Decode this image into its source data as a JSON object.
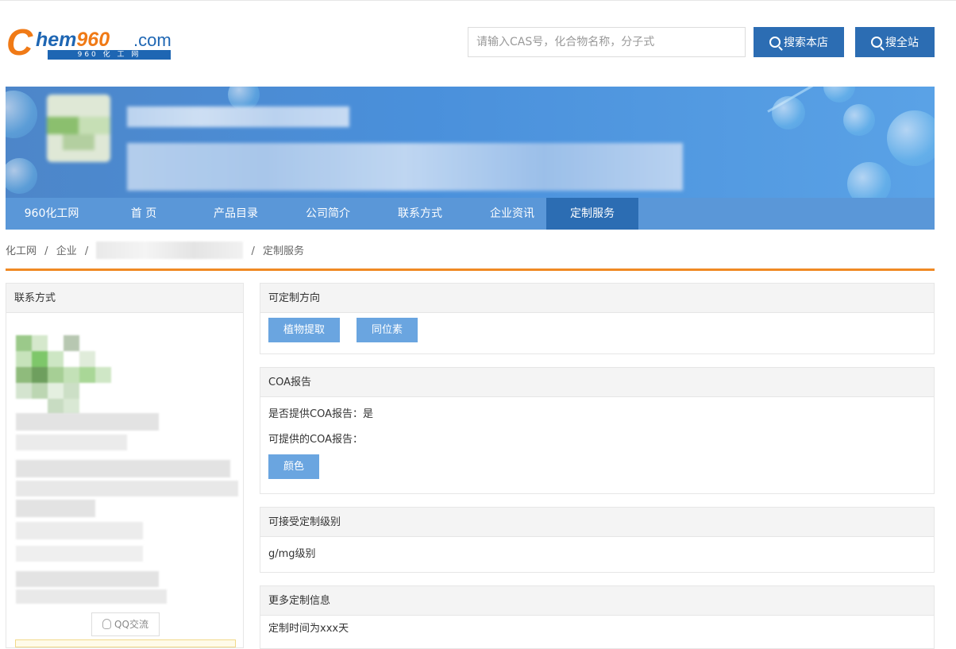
{
  "header": {
    "logo": {
      "c": "C",
      "hem": "hem",
      "num": "960",
      "dotcom": ".com",
      "sub": "960 化 工 网"
    },
    "search_placeholder": "请输入CAS号，化合物名称，分子式",
    "search_store_label": "搜索本店",
    "search_all_label": "搜全站"
  },
  "nav": {
    "items": [
      "960化工网",
      "首 页",
      "产品目录",
      "公司简介",
      "联系方式",
      "企业资讯",
      "定制服务"
    ],
    "active_index": 6
  },
  "breadcrumb": {
    "items": [
      "化工网",
      "企业",
      "定制服务"
    ],
    "separator": "/"
  },
  "sidebar": {
    "title": "联系方式",
    "qq_label": "QQ交流"
  },
  "panels": {
    "direction": {
      "title": "可定制方向",
      "tags": [
        "植物提取",
        "同位素"
      ]
    },
    "coa": {
      "title": "COA报告",
      "provide_line": "是否提供COA报告：是",
      "available_label": "可提供的COA报告：",
      "tags": [
        "颜色"
      ]
    },
    "level": {
      "title": "可接受定制级别",
      "value": "g/mg级别"
    },
    "more": {
      "title": "更多定制信息",
      "value": "定制时间为xxx天"
    }
  },
  "colors": {
    "primary_blue": "#2c6db3",
    "nav_blue": "#5a97d8",
    "tag_blue": "#6aa5e0",
    "orange": "#f08a24"
  }
}
